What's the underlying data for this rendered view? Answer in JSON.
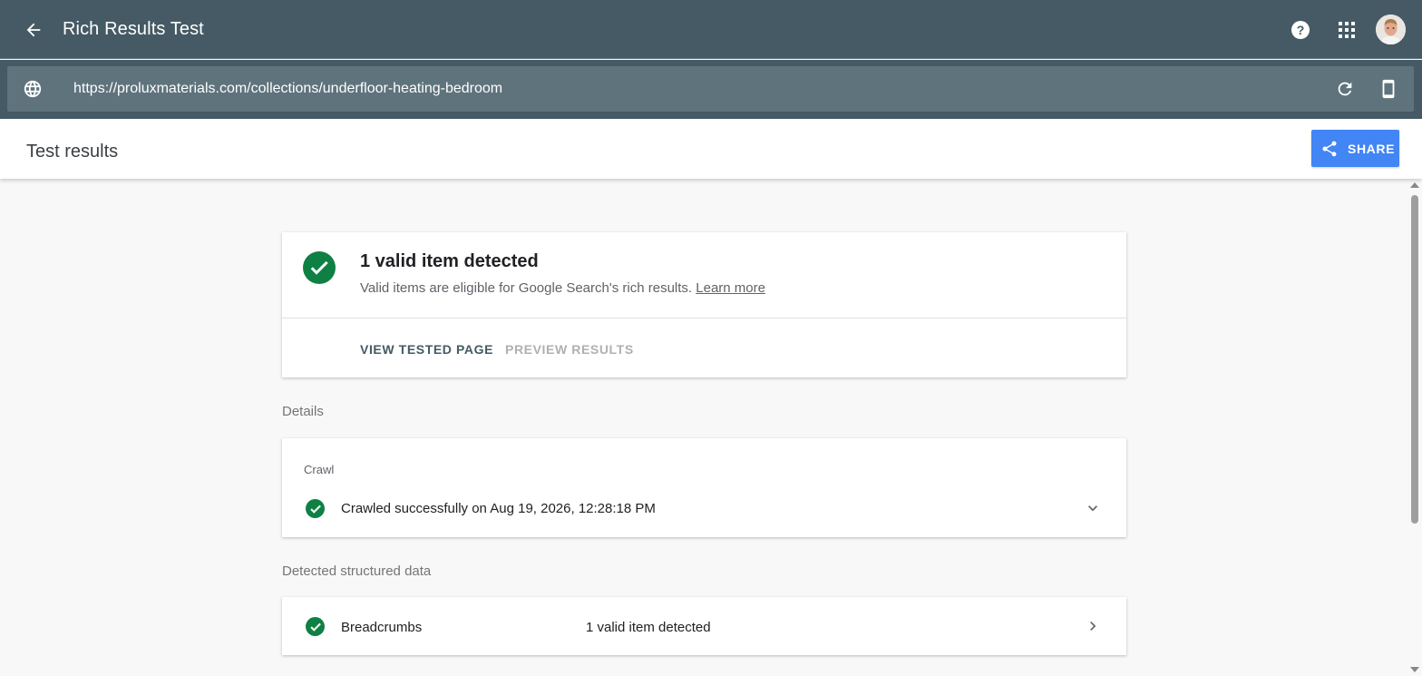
{
  "app": {
    "title": "Rich Results Test",
    "back_icon": "arrow-left-icon",
    "help_icon": "help-icon",
    "apps_icon": "apps-grid-icon",
    "avatar_icon": "user-avatar"
  },
  "urlbar": {
    "url": "https://proluxmaterials.com/collections/underfloor-heating-bedroom",
    "globe_icon": "globe-icon",
    "reload_icon": "reload-icon",
    "device_icon": "smartphone-icon"
  },
  "results_header": {
    "title": "Test results",
    "share_label": "SHARE",
    "share_icon": "share-icon",
    "share_color": "#4285f4"
  },
  "summary": {
    "title": "1 valid item detected",
    "subtitle": "Valid items are eligible for Google Search's rich results.",
    "learn_more": "Learn more",
    "view_tested_page": "VIEW TESTED PAGE",
    "preview_results": "PREVIEW RESULTS",
    "status_color": "#0f8043"
  },
  "details": {
    "label": "Details",
    "crawl": {
      "label": "Crawl",
      "status_text": "Crawled successfully on Aug 19, 2026, 12:28:18 PM",
      "expand_icon": "chevron-down-icon"
    }
  },
  "structured_data": {
    "label": "Detected structured data",
    "items": [
      {
        "name": "Breadcrumbs",
        "status": "1 valid item detected",
        "icon": "chevron-right-icon"
      }
    ]
  }
}
